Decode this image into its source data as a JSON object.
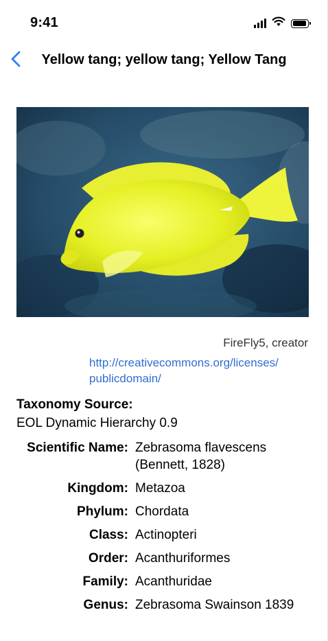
{
  "status_bar": {
    "time": "9:41"
  },
  "nav": {
    "title": "Yellow tang; yellow tang; Yellow Tang",
    "back_icon": "chevron-left-icon"
  },
  "photo": {
    "subject": "yellow tang fish"
  },
  "attribution": {
    "creator": "FireFly5, creator",
    "license_line1": "http://creativecommons.org/licenses/",
    "license_line2": "publicdomain/"
  },
  "taxonomy": {
    "source_label": "Taxonomy Source:",
    "source_value": "EOL Dynamic Hierarchy 0.9",
    "rows": [
      {
        "label": "Scientific Name:",
        "value": "Zebrasoma flavescens (Bennett, 1828)"
      },
      {
        "label": "Kingdom:",
        "value": "Metazoa"
      },
      {
        "label": "Phylum:",
        "value": "Chordata"
      },
      {
        "label": "Class:",
        "value": "Actinopteri"
      },
      {
        "label": "Order:",
        "value": "Acanthuriformes"
      },
      {
        "label": "Family:",
        "value": "Acanthuridae"
      },
      {
        "label": "Genus:",
        "value": "Zebrasoma Swainson 1839"
      }
    ]
  },
  "colors": {
    "link": "#2f6fd1",
    "accent": "#2f7ff5"
  }
}
